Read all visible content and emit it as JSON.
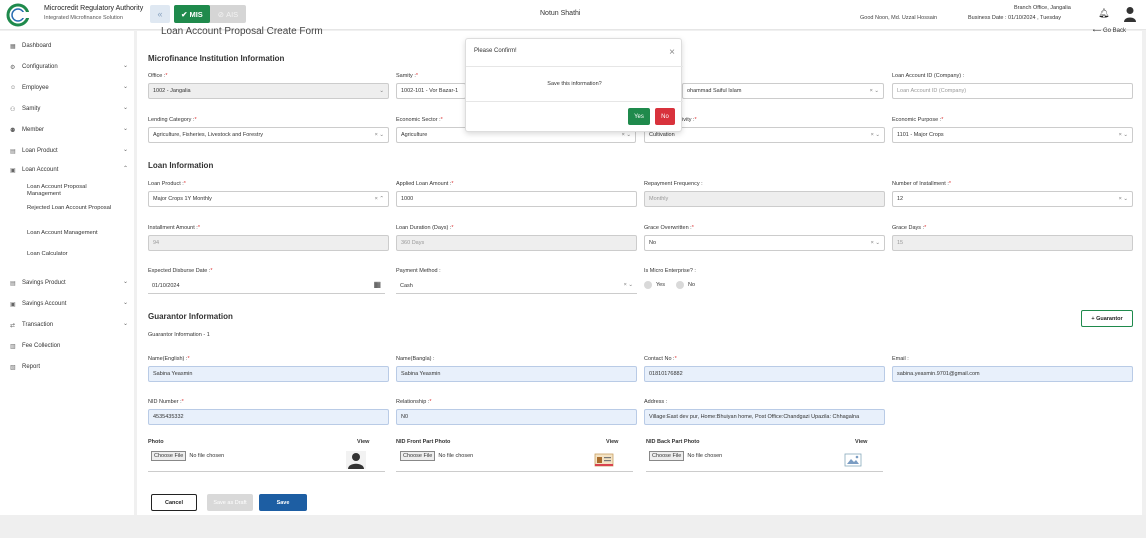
{
  "header": {
    "brand_title": "Microcredit Regulatory Authority",
    "brand_sub": "Integrated Microfinance Solution",
    "mis_label": "MIS",
    "ais_label": "AIS",
    "app_name": "Notun Shathi",
    "greeting": "Good Noon, Md. Uzzal Hossain",
    "branch": "Branch Office, Jangalia",
    "business_date": "Business Date : 01/10/2024 , Tuesday"
  },
  "sidebar": {
    "items": [
      {
        "label": "Dashboard",
        "icon": "dashboard-icon"
      },
      {
        "label": "Configuration",
        "icon": "config-icon"
      },
      {
        "label": "Employee",
        "icon": "employee-icon"
      },
      {
        "label": "Samity",
        "icon": "samity-icon"
      },
      {
        "label": "Member",
        "icon": "member-icon"
      },
      {
        "label": "Loan Product",
        "icon": "loan-product-icon"
      },
      {
        "label": "Loan Account",
        "icon": "loan-account-icon"
      },
      {
        "label": "Savings Product",
        "icon": "savings-product-icon"
      },
      {
        "label": "Savings Account",
        "icon": "savings-account-icon"
      },
      {
        "label": "Transaction",
        "icon": "transaction-icon"
      },
      {
        "label": "Fee Collection",
        "icon": "fee-icon"
      },
      {
        "label": "Report",
        "icon": "report-icon"
      }
    ],
    "loan_account_sub": [
      "Loan Account Proposal Management",
      "Rejected Loan Account Proposal",
      "Loan Account Management",
      "Loan Calculator"
    ]
  },
  "main": {
    "page_title": "Loan Account Proposal Create Form",
    "go_back": "Go Back",
    "section_mfi": "Microfinance Institution Information",
    "section_loan": "Loan Information",
    "section_guarantor": "Guarantor Information",
    "guarantor_sub": "Guarantor Information - 1",
    "add_guarantor": "Guarantor",
    "fields": {
      "office_label": "Office :",
      "office_value": "1002 - Jangalia",
      "samity_label": "Samity :",
      "samity_value": "1002-101 - Vor Bazar-1",
      "member_value": "ohammad Saiful Islam",
      "loan_acc_id_label": "Loan Account ID (Company) :",
      "loan_acc_id_placeholder": "Loan Account ID (Company)",
      "lending_label": "Lending Category :",
      "lending_value": "Agriculture, Fisheries, Livestock and Forestry",
      "econ_sector_label": "Economic Sector :",
      "econ_sector_value": "Agriculture",
      "activity_label": "ivity :",
      "activity_value": "Cultivation",
      "econ_purpose_label": "Economic Purpose :",
      "econ_purpose_value": "1101 - Major Crops",
      "loan_product_label": "Loan Product :",
      "loan_product_value": "Major Crops 1Y Monthly",
      "applied_amount_label": "Applied Loan Amount :",
      "applied_amount_value": "1000",
      "repay_freq_label": "Repayment Frequency :",
      "repay_freq_value": "Monthly",
      "num_install_label": "Number of Installment :",
      "num_install_value": "12",
      "install_amount_label": "Installment Amount :",
      "install_amount_value": "94",
      "loan_duration_label": "Loan Duration (Days) :",
      "loan_duration_value": "360 Days",
      "grace_over_label": "Grace Overwritten :",
      "grace_over_value": "No",
      "grace_days_label": "Grace Days :",
      "grace_days_value": "15",
      "disburse_date_label": "Expected Disburse Date :",
      "disburse_date_value": "01/10/2024",
      "payment_method_label": "Payment Method :",
      "payment_method_value": "Cash",
      "micro_ent_label": "Is Micro Enterprise? :",
      "micro_yes": "Yes",
      "micro_no": "No",
      "name_en_label": "Name(English) :",
      "name_en_value": "Sabina Yeasmin",
      "name_bn_label": "Name(Bangla) :",
      "name_bn_value": "Sabina Yeasmin",
      "contact_label": "Contact No :",
      "contact_value": "01810176882",
      "email_label": "Email :",
      "email_value": "sabina.yeasmin.9701@gmail.com",
      "nid_label": "NID Number :",
      "nid_value": "4535435332",
      "relationship_label": "Relationship :",
      "relationship_value": "N0",
      "address_label": "Address :",
      "address_value": "Village:East dev pur, Home:Bhuiyan home, Post Office:Chandgazi Upazila: Chhagalna",
      "photo_label": "Photo",
      "nid_front_label": "NID Front Part Photo",
      "nid_back_label": "NID Back Part Photo",
      "view_label": "View",
      "choose_file": "Choose File",
      "no_file": "No file chosen"
    },
    "buttons": {
      "cancel": "Cancel",
      "draft": "Save as Draft",
      "save": "Save"
    }
  },
  "modal": {
    "title": "Please Confirm!",
    "message": "Save this information?",
    "yes": "Yes",
    "no": "No"
  },
  "colors": {
    "green": "#1f8a4c",
    "red": "#d8323c",
    "blue": "#1d5ea3"
  }
}
